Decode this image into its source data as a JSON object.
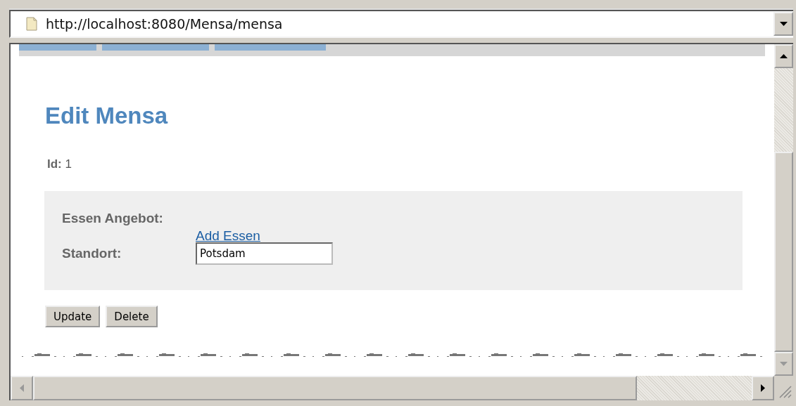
{
  "address_bar": {
    "url": "http://localhost:8080/Mensa/mensa"
  },
  "heading": "Edit Mensa",
  "id_line": {
    "label": "Id:",
    "value": "1"
  },
  "fields": [
    {
      "label": "Essen Angebot:",
      "kind": "link",
      "text": "Add Essen"
    },
    {
      "label": "Standort:",
      "kind": "input",
      "value": "Potsdam"
    }
  ],
  "buttons": [
    "Update",
    "Delete"
  ]
}
